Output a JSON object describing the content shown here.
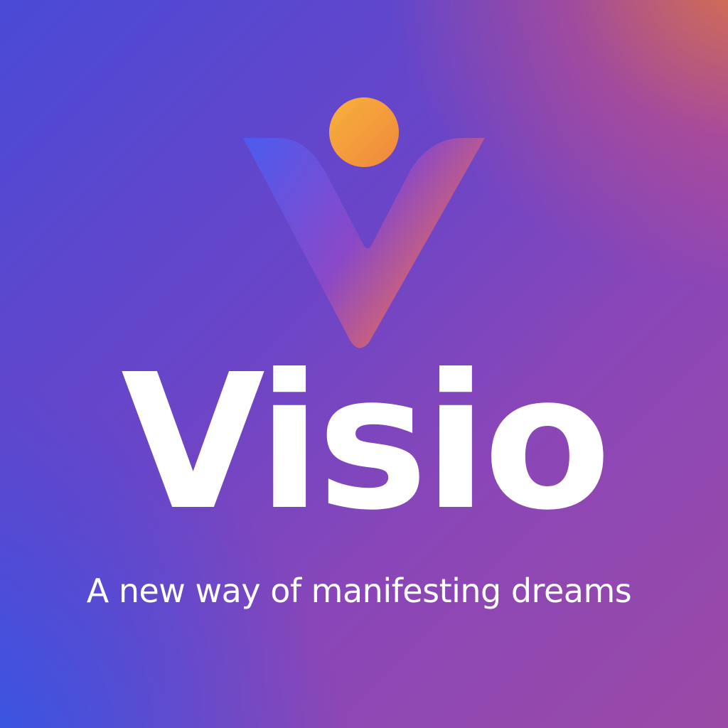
{
  "brand": {
    "name": "Visio",
    "tagline": "A new way of manifesting dreams"
  },
  "colors": {
    "text": "#ffffff",
    "background_start": "#2f5cf0",
    "background_mid": "#7a45c0",
    "background_end": "#e07a40",
    "logo_left": "#4b5cf0",
    "logo_right": "#f07050",
    "logo_dot": "#f5a83c"
  },
  "logo": {
    "icon": "v-person-icon"
  }
}
